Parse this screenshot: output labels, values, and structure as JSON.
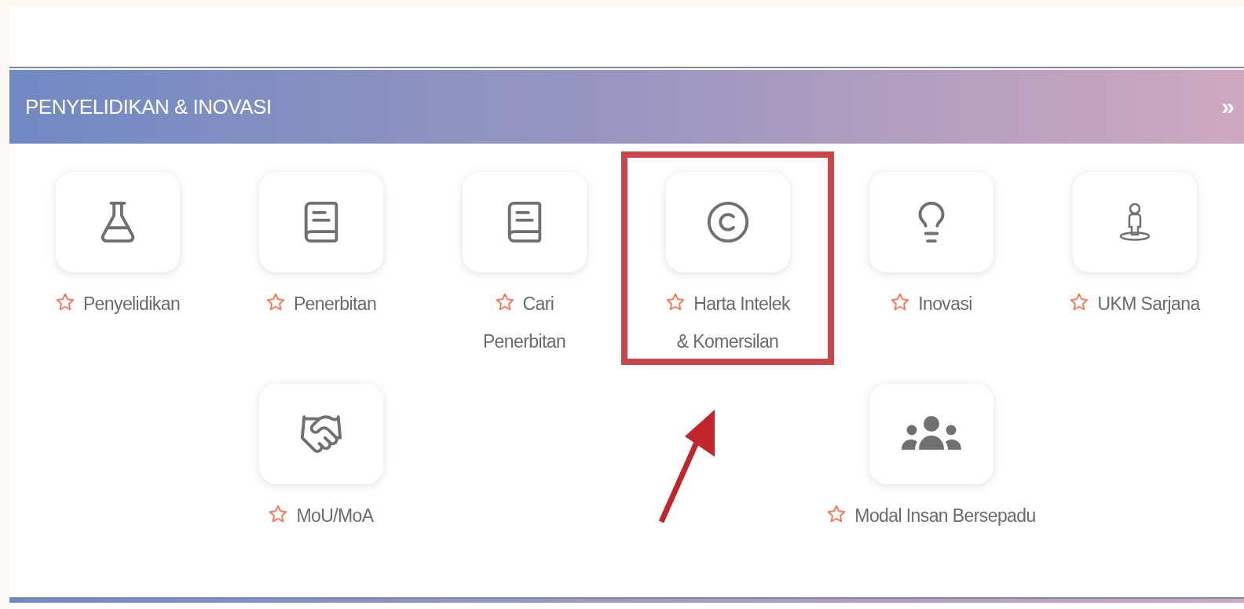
{
  "section": {
    "title": "PENYELIDIKAN & INOVASI",
    "more": "»"
  },
  "rows": [
    [
      {
        "label": "Penyelidikan",
        "highlighted": false
      },
      {
        "label": "Penerbitan",
        "highlighted": false
      },
      {
        "label": "Cari Penerbitan",
        "highlighted": false
      },
      {
        "label": "Harta Intelek & Komersilan",
        "highlighted": true
      },
      {
        "label": "Inovasi",
        "highlighted": false
      },
      {
        "label": "UKM Sarjana",
        "highlighted": false
      }
    ],
    [
      {
        "label": "MoU/MoA",
        "highlighted": false
      },
      {
        "label": "Modal Insan Bersepadu",
        "highlighted": false
      }
    ]
  ]
}
